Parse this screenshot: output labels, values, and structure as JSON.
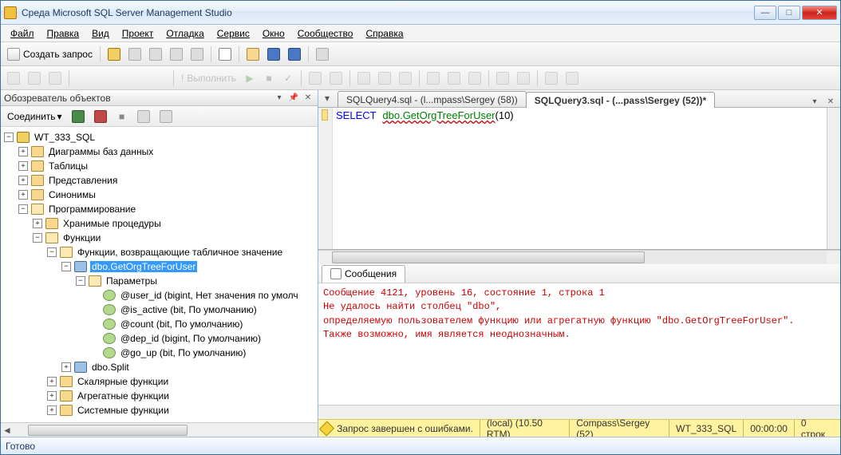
{
  "window": {
    "title": "Среда Microsoft SQL Server Management Studio"
  },
  "menu": {
    "file": "Файл",
    "edit": "Правка",
    "view": "Вид",
    "project": "Проект",
    "debug": "Отладка",
    "service": "Сервис",
    "window": "Окно",
    "community": "Сообщество",
    "help": "Справка"
  },
  "toolbar": {
    "new_query": "Создать запрос",
    "execute": "Выполнить"
  },
  "object_explorer": {
    "title": "Обозреватель объектов",
    "connect_label": "Соединить",
    "tree": {
      "root": "WT_333_SQL",
      "diagrams": "Диаграммы баз данных",
      "tables": "Таблицы",
      "views": "Представления",
      "synonyms": "Синонимы",
      "programmability": "Программирование",
      "stored_procs": "Хранимые процедуры",
      "functions": "Функции",
      "table_funcs": "Функции, возвращающие табличное значение",
      "fn_selected": "dbo.GetOrgTreeForUser",
      "parameters": "Параметры",
      "params": [
        "@user_id (bigint, Нет значения по умолч",
        "@is_active (bit, По умолчанию)",
        "@count (bit, По умолчанию)",
        "@dep_id (bigint, По умолчанию)",
        "@go_up (bit, По умолчанию)"
      ],
      "fn_split": "dbo.Split",
      "scalar_funcs": "Скалярные функции",
      "aggregate_funcs": "Агрегатные функции",
      "system_funcs": "Системные функции"
    }
  },
  "tabs": {
    "inactive": "SQLQuery4.sql - (l...mpass\\Sergey (58))",
    "active": "SQLQuery3.sql - (...pass\\Sergey (52))*"
  },
  "editor": {
    "kw_select": "SELECT",
    "fn_call": "dbo.GetOrgTreeForUser",
    "arg": "(10)"
  },
  "messages": {
    "tab": "Сообщения",
    "text": "Сообщение 4121, уровень 16, состояние 1, строка 1\nНе удалось найти столбец \"dbo\",\nопределяемую пользователем функцию или агрегатную функцию \"dbo.GetOrgTreeForUser\".\nТакже возможно, имя является неоднозначным."
  },
  "query_status": {
    "summary": "Запрос завершен с ошибками.",
    "server": "(local) (10.50 RTM)",
    "login": "Compass\\Sergey (52)",
    "db": "WT_333_SQL",
    "elapsed": "00:00:00",
    "rows": "0 строк"
  },
  "statusbar": {
    "ready": "Готово"
  }
}
